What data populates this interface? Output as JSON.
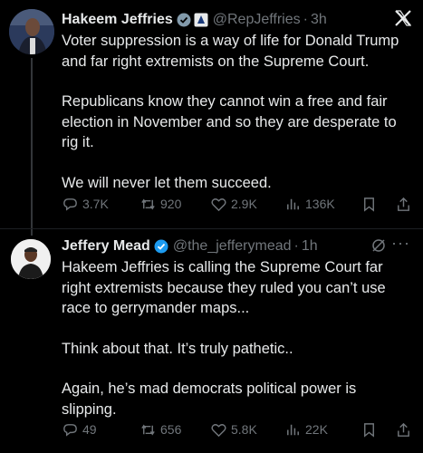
{
  "tweets": [
    {
      "author_name": "Hakeem Jeffries",
      "handle": "@RepJeffries",
      "separator": "·",
      "time": "3h",
      "paragraphs": [
        "Voter suppression is a way of life for Donald Trump and far right extremists on the Supreme Court.",
        "Republicans know they cannot win a free and fair election in November and so they are desperate to rig it.",
        "We will never let them succeed."
      ],
      "stats": {
        "replies": "3.7K",
        "reposts": "920",
        "likes": "2.9K",
        "views": "136K"
      }
    },
    {
      "author_name": "Jeffery Mead",
      "handle": "@the_jefferymead",
      "separator": "·",
      "time": "1h",
      "paragraphs": [
        "Hakeem Jeffries is calling the Supreme Court far right extremists because they ruled you can’t use race to gerrymander maps...",
        "Think about that. It’s truly pathetic..",
        "Again, he’s mad democrats political power is slipping."
      ],
      "stats": {
        "replies": "49",
        "reposts": "656",
        "likes": "5.8K",
        "views": "22K"
      }
    }
  ],
  "colors": {
    "background": "#000000",
    "text": "#e7e9ea",
    "muted": "#71767b",
    "verified": "#1d9bf0"
  },
  "icons": [
    "verified-badge-icon",
    "government-badge-icon",
    "x-logo-icon",
    "grok-icon",
    "more-icon",
    "reply-icon",
    "repost-icon",
    "like-icon",
    "views-icon",
    "bookmark-icon",
    "share-icon"
  ]
}
